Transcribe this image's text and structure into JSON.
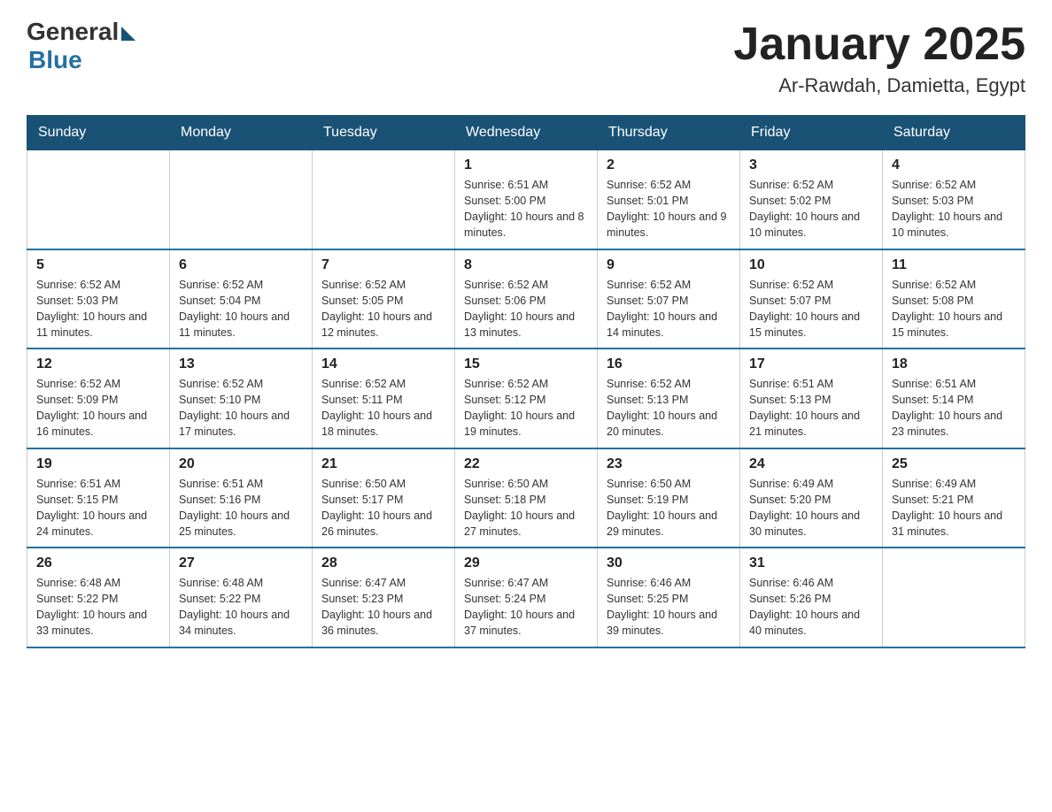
{
  "header": {
    "logo_general": "General",
    "logo_blue": "Blue",
    "title": "January 2025",
    "subtitle": "Ar-Rawdah, Damietta, Egypt"
  },
  "days_of_week": [
    "Sunday",
    "Monday",
    "Tuesday",
    "Wednesday",
    "Thursday",
    "Friday",
    "Saturday"
  ],
  "weeks": [
    [
      {
        "day": "",
        "info": ""
      },
      {
        "day": "",
        "info": ""
      },
      {
        "day": "",
        "info": ""
      },
      {
        "day": "1",
        "info": "Sunrise: 6:51 AM\nSunset: 5:00 PM\nDaylight: 10 hours and 8 minutes."
      },
      {
        "day": "2",
        "info": "Sunrise: 6:52 AM\nSunset: 5:01 PM\nDaylight: 10 hours and 9 minutes."
      },
      {
        "day": "3",
        "info": "Sunrise: 6:52 AM\nSunset: 5:02 PM\nDaylight: 10 hours and 10 minutes."
      },
      {
        "day": "4",
        "info": "Sunrise: 6:52 AM\nSunset: 5:03 PM\nDaylight: 10 hours and 10 minutes."
      }
    ],
    [
      {
        "day": "5",
        "info": "Sunrise: 6:52 AM\nSunset: 5:03 PM\nDaylight: 10 hours and 11 minutes."
      },
      {
        "day": "6",
        "info": "Sunrise: 6:52 AM\nSunset: 5:04 PM\nDaylight: 10 hours and 11 minutes."
      },
      {
        "day": "7",
        "info": "Sunrise: 6:52 AM\nSunset: 5:05 PM\nDaylight: 10 hours and 12 minutes."
      },
      {
        "day": "8",
        "info": "Sunrise: 6:52 AM\nSunset: 5:06 PM\nDaylight: 10 hours and 13 minutes."
      },
      {
        "day": "9",
        "info": "Sunrise: 6:52 AM\nSunset: 5:07 PM\nDaylight: 10 hours and 14 minutes."
      },
      {
        "day": "10",
        "info": "Sunrise: 6:52 AM\nSunset: 5:07 PM\nDaylight: 10 hours and 15 minutes."
      },
      {
        "day": "11",
        "info": "Sunrise: 6:52 AM\nSunset: 5:08 PM\nDaylight: 10 hours and 15 minutes."
      }
    ],
    [
      {
        "day": "12",
        "info": "Sunrise: 6:52 AM\nSunset: 5:09 PM\nDaylight: 10 hours and 16 minutes."
      },
      {
        "day": "13",
        "info": "Sunrise: 6:52 AM\nSunset: 5:10 PM\nDaylight: 10 hours and 17 minutes."
      },
      {
        "day": "14",
        "info": "Sunrise: 6:52 AM\nSunset: 5:11 PM\nDaylight: 10 hours and 18 minutes."
      },
      {
        "day": "15",
        "info": "Sunrise: 6:52 AM\nSunset: 5:12 PM\nDaylight: 10 hours and 19 minutes."
      },
      {
        "day": "16",
        "info": "Sunrise: 6:52 AM\nSunset: 5:13 PM\nDaylight: 10 hours and 20 minutes."
      },
      {
        "day": "17",
        "info": "Sunrise: 6:51 AM\nSunset: 5:13 PM\nDaylight: 10 hours and 21 minutes."
      },
      {
        "day": "18",
        "info": "Sunrise: 6:51 AM\nSunset: 5:14 PM\nDaylight: 10 hours and 23 minutes."
      }
    ],
    [
      {
        "day": "19",
        "info": "Sunrise: 6:51 AM\nSunset: 5:15 PM\nDaylight: 10 hours and 24 minutes."
      },
      {
        "day": "20",
        "info": "Sunrise: 6:51 AM\nSunset: 5:16 PM\nDaylight: 10 hours and 25 minutes."
      },
      {
        "day": "21",
        "info": "Sunrise: 6:50 AM\nSunset: 5:17 PM\nDaylight: 10 hours and 26 minutes."
      },
      {
        "day": "22",
        "info": "Sunrise: 6:50 AM\nSunset: 5:18 PM\nDaylight: 10 hours and 27 minutes."
      },
      {
        "day": "23",
        "info": "Sunrise: 6:50 AM\nSunset: 5:19 PM\nDaylight: 10 hours and 29 minutes."
      },
      {
        "day": "24",
        "info": "Sunrise: 6:49 AM\nSunset: 5:20 PM\nDaylight: 10 hours and 30 minutes."
      },
      {
        "day": "25",
        "info": "Sunrise: 6:49 AM\nSunset: 5:21 PM\nDaylight: 10 hours and 31 minutes."
      }
    ],
    [
      {
        "day": "26",
        "info": "Sunrise: 6:48 AM\nSunset: 5:22 PM\nDaylight: 10 hours and 33 minutes."
      },
      {
        "day": "27",
        "info": "Sunrise: 6:48 AM\nSunset: 5:22 PM\nDaylight: 10 hours and 34 minutes."
      },
      {
        "day": "28",
        "info": "Sunrise: 6:47 AM\nSunset: 5:23 PM\nDaylight: 10 hours and 36 minutes."
      },
      {
        "day": "29",
        "info": "Sunrise: 6:47 AM\nSunset: 5:24 PM\nDaylight: 10 hours and 37 minutes."
      },
      {
        "day": "30",
        "info": "Sunrise: 6:46 AM\nSunset: 5:25 PM\nDaylight: 10 hours and 39 minutes."
      },
      {
        "day": "31",
        "info": "Sunrise: 6:46 AM\nSunset: 5:26 PM\nDaylight: 10 hours and 40 minutes."
      },
      {
        "day": "",
        "info": ""
      }
    ]
  ]
}
